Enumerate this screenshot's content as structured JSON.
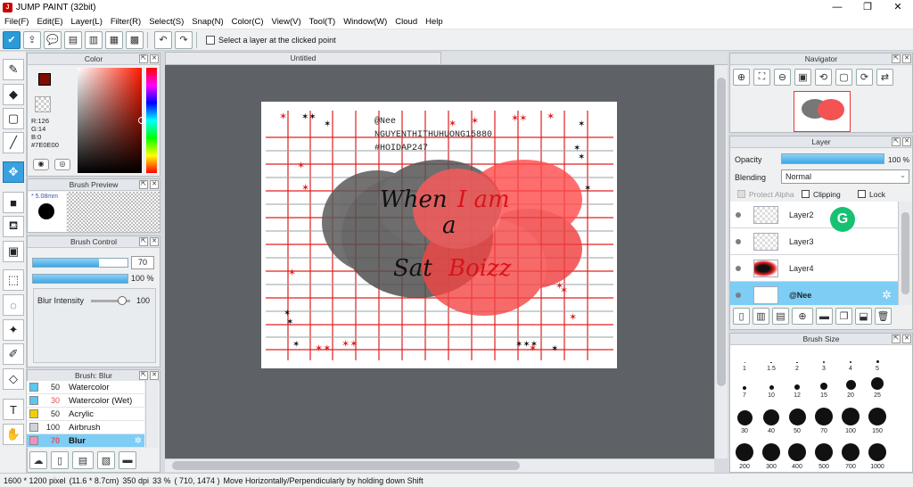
{
  "window": {
    "title": "JUMP PAINT (32bit)"
  },
  "menu": [
    "File(F)",
    "Edit(E)",
    "Layer(L)",
    "Filter(R)",
    "Select(S)",
    "Snap(N)",
    "Color(C)",
    "View(V)",
    "Tool(T)",
    "Window(W)",
    "Cloud",
    "Help"
  ],
  "toolbar": {
    "hint": "Select a layer at the clicked point"
  },
  "color_panel": {
    "title": "Color",
    "r": "R:126",
    "g": "G:14",
    "b": "B:0",
    "hex": "#7E0E00",
    "current": "#7E0E00"
  },
  "brush_preview": {
    "title": "Brush Preview",
    "size": "5.08mm"
  },
  "brush_control": {
    "title": "Brush Control",
    "size_value": "70",
    "size_fill": 0.7,
    "opacity_value": "100 %",
    "blur_label": "Blur Intensity",
    "blur_value": "100"
  },
  "brush_list": {
    "title": "Brush: Blur",
    "items": [
      {
        "num": "50",
        "name": "Watercolor",
        "color": "#5bc8f0"
      },
      {
        "num": "30",
        "name": "Watercolor (Wet)",
        "color": "#5bc8f0"
      },
      {
        "num": "50",
        "name": "Acrylic",
        "color": "#f0d000"
      },
      {
        "num": "100",
        "name": "Airbrush",
        "color": "#d0d4d8"
      },
      {
        "num": "70",
        "name": "Blur",
        "color": "#f090c0"
      }
    ]
  },
  "document": {
    "tab": "Untitled"
  },
  "artwork": {
    "line1": "@Nee",
    "line2": "NGUYENTHITHUHUONG15880",
    "line3": "#HOIDAP247",
    "w1": "When",
    "w2": "I am",
    "w3": "a",
    "w4": "Sat",
    "w5": "Boizz"
  },
  "navigator": {
    "title": "Navigator"
  },
  "layer_panel": {
    "title": "Layer",
    "opacity_label": "Opacity",
    "opacity_value": "100 %",
    "blending_label": "Blending",
    "blending_value": "Normal",
    "protect_alpha": "Protect Alpha",
    "clipping": "Clipping",
    "lock": "Lock",
    "layers": [
      {
        "name": "Layer2"
      },
      {
        "name": "Layer3"
      },
      {
        "name": "Layer4"
      },
      {
        "name": "@Nee"
      }
    ]
  },
  "brush_size": {
    "title": "Brush Size",
    "sizes": [
      "1",
      "1.5",
      "2",
      "3",
      "4",
      "5",
      "7",
      "10",
      "12",
      "15",
      "20",
      "25",
      "30",
      "40",
      "50",
      "70",
      "100",
      "150",
      "200",
      "300",
      "400",
      "500",
      "700",
      "1000"
    ]
  },
  "status": {
    "dims": "1600 * 1200 pixel",
    "cm": "(11.6 * 8.7cm)",
    "dpi": "350 dpi",
    "zoom": "33 %",
    "coords": "( 710, 1474 )",
    "hint": "Move Horizontally/Perpendicularly by holding down Shift"
  }
}
